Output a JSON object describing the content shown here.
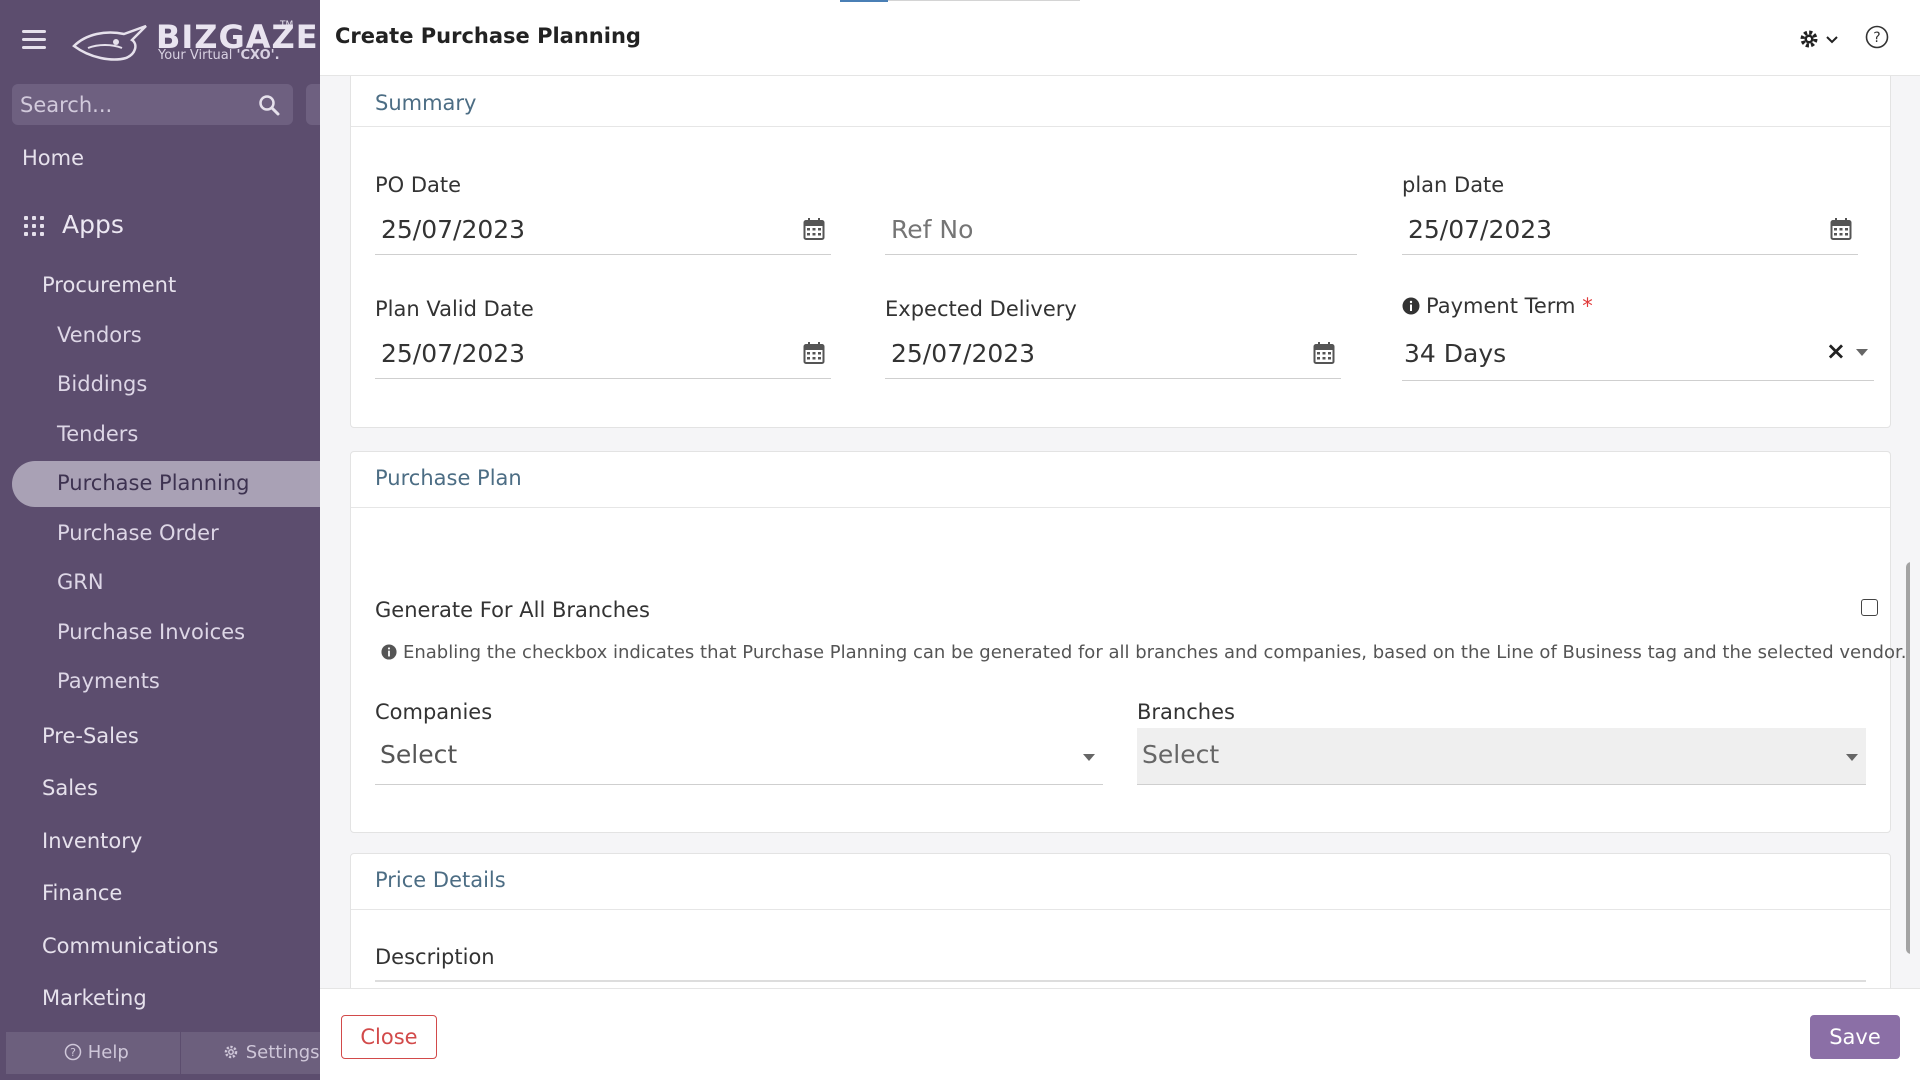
{
  "sidebar": {
    "logo": {
      "brand": "BIZGAZE",
      "tm": "TM",
      "tagline_prefix": "Your Virtual ",
      "tagline_bold": "'CXO'."
    },
    "search": {
      "placeholder": "Search..."
    },
    "home": "Home",
    "apps_label": "Apps",
    "procurement": "Procurement",
    "procurement_items": [
      "Vendors",
      "Biddings",
      "Tenders",
      "Purchase Planning",
      "Purchase Order",
      "GRN",
      "Purchase Invoices",
      "Payments"
    ],
    "active_item": "Purchase Planning",
    "sections": [
      "Pre-Sales",
      "Sales",
      "Inventory",
      "Finance",
      "Communications",
      "Marketing"
    ],
    "bottom": {
      "help": "Help",
      "settings": "Settings"
    }
  },
  "header": {
    "title": "Create Purchase Planning"
  },
  "summary": {
    "title": "Summary",
    "po_date": {
      "label": "PO Date",
      "value": "25/07/2023"
    },
    "ref_no": {
      "placeholder": "Ref No"
    },
    "plan_date": {
      "label": "plan Date",
      "value": "25/07/2023"
    },
    "plan_valid_date": {
      "label": "Plan Valid Date",
      "value": "25/07/2023"
    },
    "expected_delivery": {
      "label": "Expected Delivery",
      "value": "25/07/2023"
    },
    "payment_term": {
      "label": "Payment Term",
      "required_mark": "*",
      "value": "34 Days",
      "clear": "×"
    }
  },
  "purchase_plan": {
    "title": "Purchase Plan",
    "generate_all": {
      "label": "Generate For All Branches",
      "checked": false
    },
    "note": "Enabling the checkbox indicates that Purchase Planning can be generated for all branches and companies, based on the Line of Business tag and the selected vendor.",
    "companies": {
      "label": "Companies",
      "value": "Select"
    },
    "branches": {
      "label": "Branches",
      "value": "Select"
    }
  },
  "price_details": {
    "title": "Price Details",
    "description_label": "Description"
  },
  "footer": {
    "close_label": "Close",
    "save_label": "Save"
  },
  "colors": {
    "sidebar_bg": "#5c4d6e",
    "active_item_bg": "#a9a1b5",
    "save_bg": "#8b6fa6",
    "close_border": "#d24a4a",
    "section_title": "#4c6d84"
  }
}
